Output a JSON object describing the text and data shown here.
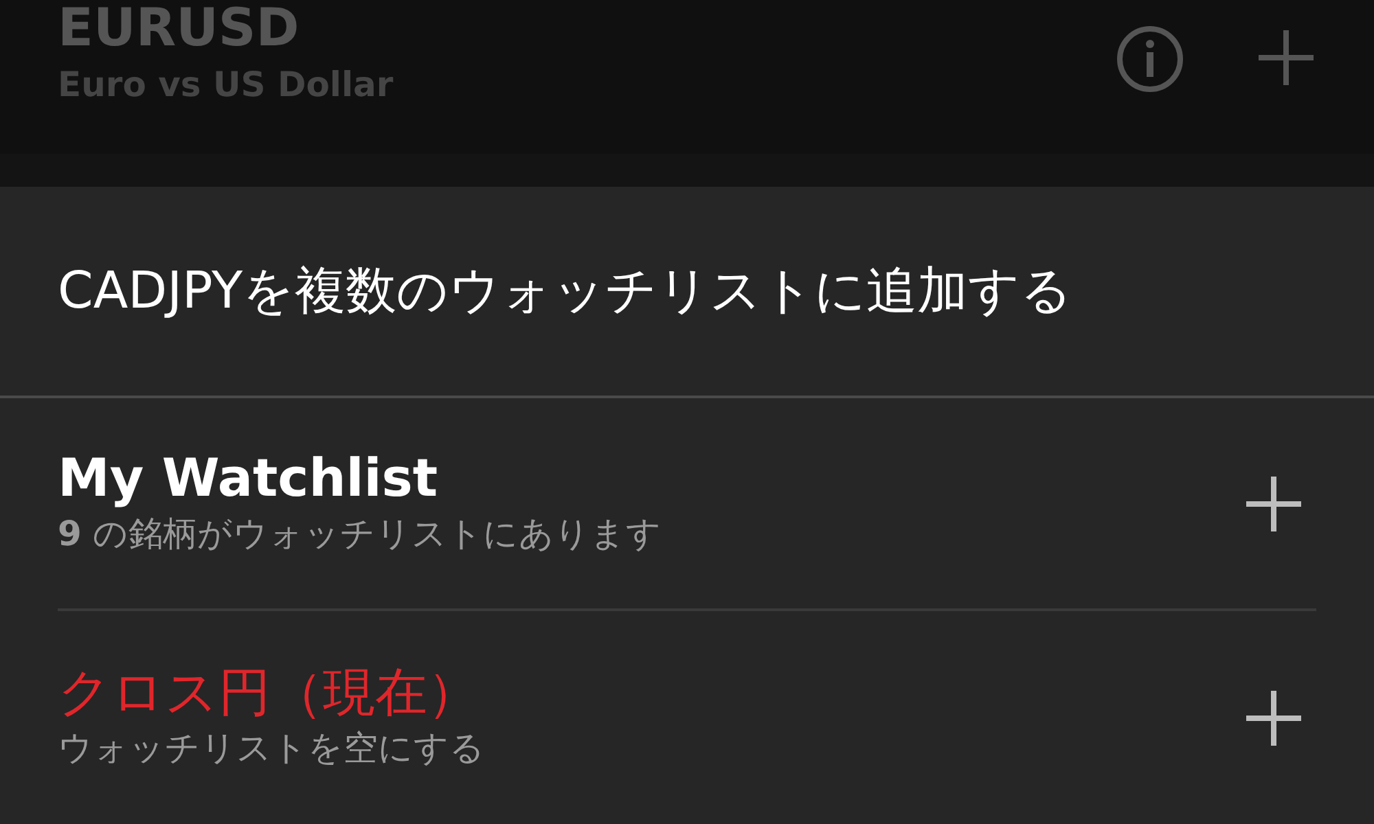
{
  "background_item": {
    "symbol": "EURUSD",
    "description": "Euro vs US Dollar"
  },
  "sheet": {
    "title": "CADJPYを複数のウォッチリストに追加する",
    "watchlists": [
      {
        "name": "My Watchlist",
        "subtitle": "**9** の銘柄がウォッチリストにあります",
        "current": false
      },
      {
        "name": "クロス円（現在）",
        "subtitle": "ウォッチリストを空にする",
        "current": true
      }
    ]
  }
}
